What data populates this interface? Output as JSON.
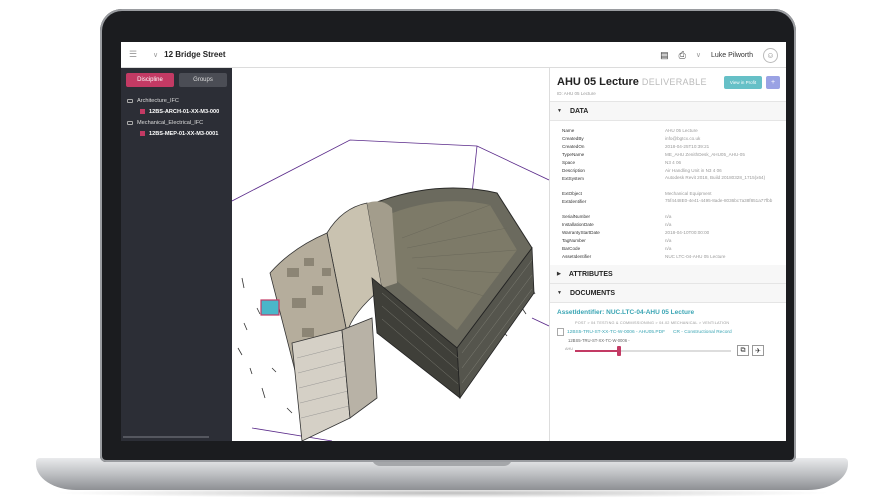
{
  "topbar": {
    "project_title": "12 Bridge Street",
    "user_name": "Luke Pilworth"
  },
  "left_panel": {
    "tabs": [
      {
        "label": "Discipline",
        "active": true
      },
      {
        "label": "Groups",
        "active": false
      }
    ],
    "tree": [
      {
        "label": "Architecture_IFC",
        "child": "12BS-ARCH-01-XX-M3-000"
      },
      {
        "label": "Mechanical_Electrical_IFC",
        "child": "12BS-MEP-01-XX-M3-0001"
      }
    ]
  },
  "right_panel": {
    "title": "AHU 05 Lecture",
    "status": "DELIVERABLE",
    "subtitle": "ID: AHU 05 Lecture",
    "profit_button": "View in Profit",
    "plus_button": "+",
    "sections": {
      "data": "DATA",
      "attributes": "ATTRIBUTES",
      "documents": "DOCUMENTS"
    },
    "properties": [
      {
        "key": "Name",
        "value": "AHU 05 Lecture"
      },
      {
        "key": "CreatedBy",
        "value": "info@bgtcx.co.uk"
      },
      {
        "key": "CreatedOn",
        "value": "2018-04-25T10:39:21"
      },
      {
        "key": "TypeName",
        "value": "ME_AHU ZenithDesk_AHU05_AHU-05"
      },
      {
        "key": "Space",
        "value": "N3 4 06"
      },
      {
        "key": "Description",
        "value": "Air Handling Unit in N3 4 06"
      },
      {
        "key": "ExtSystem",
        "value": "Autodesk Revit 2018, Build 20180328_1715(x64)"
      },
      {
        "key": "ExtObject",
        "value": "Mechanical Equipment"
      },
      {
        "key": "ExtIdentifier",
        "value": "75f4448E0-4e41-4495-8ade-8036bc7a38f851a77fbb"
      },
      {
        "key": "SerialNumber",
        "value": "n/a"
      },
      {
        "key": "InstallationDate",
        "value": "n/a"
      },
      {
        "key": "WarrantyStartDate",
        "value": "2018-04-10T00:00:00"
      },
      {
        "key": "TagNumber",
        "value": "n/a"
      },
      {
        "key": "BarCode",
        "value": "n/a"
      },
      {
        "key": "AssetIdentifier",
        "value": "NUC LTC-04-AHU 05 Lecture"
      }
    ],
    "documents": {
      "asset_link": "AssetIdentifier: NUC.LTC-04-AHU 05 Lecture",
      "breadcrumb": "POST  >  04 TESTING & COMMISSIONING  >  04.02 MECHANICAL  >  VENTILATION",
      "file_name": "12BS5-TRU-ST-XX-TC-W-0006 - AHU05.PDF",
      "file_status": "CR - Constructional Record",
      "file_sub": "12BS5-TRU-ST-XX-TC-W-0006 -",
      "slider_label": "AHU",
      "slider_value": 0.28
    }
  }
}
